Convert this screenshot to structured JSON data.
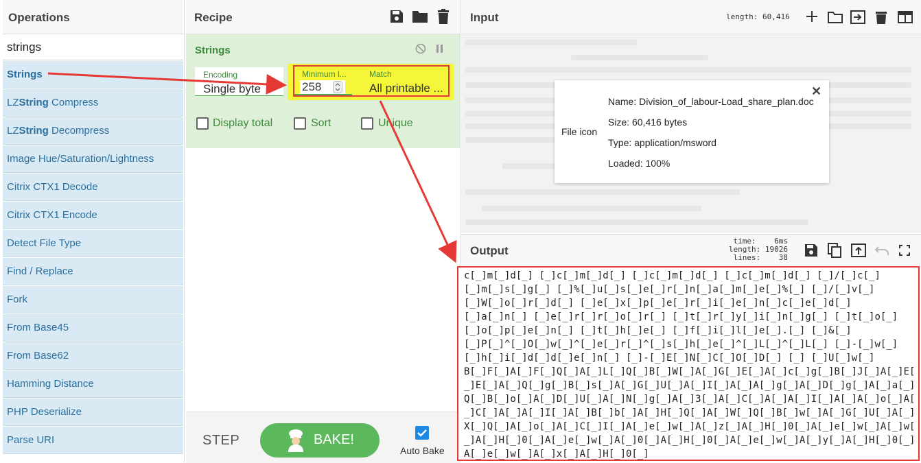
{
  "operations": {
    "title": "Operations",
    "search_value": "strings",
    "items": [
      {
        "pre": "",
        "bold": "Strings",
        "post": ""
      },
      {
        "pre": "LZ",
        "bold": "String",
        "post": " Compress"
      },
      {
        "pre": "LZ",
        "bold": "String",
        "post": " Decompress"
      },
      {
        "pre": "Image Hue/Saturation/Lightness",
        "bold": "",
        "post": ""
      },
      {
        "pre": "Citrix CTX1 Decode",
        "bold": "",
        "post": ""
      },
      {
        "pre": "Citrix CTX1 Encode",
        "bold": "",
        "post": ""
      },
      {
        "pre": "Detect File Type",
        "bold": "",
        "post": ""
      },
      {
        "pre": "Find / Replace",
        "bold": "",
        "post": ""
      },
      {
        "pre": "Fork",
        "bold": "",
        "post": ""
      },
      {
        "pre": "From Base45",
        "bold": "",
        "post": ""
      },
      {
        "pre": "From Base62",
        "bold": "",
        "post": ""
      },
      {
        "pre": "Hamming Distance",
        "bold": "",
        "post": ""
      },
      {
        "pre": "PHP Deserialize",
        "bold": "",
        "post": ""
      },
      {
        "pre": "Parse URI",
        "bold": "",
        "post": ""
      }
    ]
  },
  "recipe": {
    "title": "Recipe",
    "operation": {
      "name": "Strings",
      "encoding_label": "Encoding",
      "encoding_value": "Single byte",
      "min_length_label": "Minimum l...",
      "min_length_value": "258",
      "match_label": "Match",
      "match_value": "All printable ...",
      "display_total": "Display total",
      "sort": "Sort",
      "unique": "Unique"
    },
    "step_label": "STEP",
    "bake_label": "BAKE!",
    "auto_bake_label": "Auto Bake",
    "auto_bake_checked": true
  },
  "input": {
    "title": "Input",
    "length_text": "length: 60,416",
    "file": {
      "icon_label": "File icon",
      "name": "Name: Division_of_labour-Load_share_plan.doc",
      "size": "Size: 60,416 bytes",
      "type": "Type: application/msword",
      "loaded": "Loaded: 100%"
    }
  },
  "output": {
    "title": "Output",
    "time": "time:    6ms",
    "length": "length: 19026",
    "lines": "lines:    38",
    "text": "c[_]m[_]d[_] [_]c[_]m[_]d[_] [_]c[_]m[_]d[_] [_]c[_]m[_]d[_] [_]/[_]c[_]\n[_]m[_]s[_]g[_] [_]%[_]u[_]s[_]e[_]r[_]n[_]a[_]m[_]e[_]%[_] [_]/[_]v[_]\n[_]W[_]o[_]r[_]d[_] [_]e[_]x[_]p[_]e[_]r[_]i[_]e[_]n[_]c[_]e[_]d[_]\n[_]a[_]n[_] [_]e[_]r[_]r[_]o[_]r[_] [_]t[_]r[_]y[_]i[_]n[_]g[_] [_]t[_]o[_]\n[_]o[_]p[_]e[_]n[_] [_]t[_]h[_]e[_] [_]f[_]i[_]l[_]e[_].[_] [_]&[_]\n[_]P[_]^[_]O[_]w[_]^[_]e[_]r[_]^[_]s[_]h[_]e[_]^[_]L[_]^[_]L[_] [_]-[_]w[_]\n[_]h[_]i[_]d[_]d[_]e[_]n[_] [_]-[_]E[_]N[_]C[_]O[_]D[_] [_] [_]U[_]w[_]\nB[_]F[_]A[_]F[_]Q[_]A[_]L[_]Q[_]B[_]W[_]A[_]G[_]E[_]A[_]c[_]g[_]B[_]J[_]A[_]E[\n_]E[_]A[_]Q[_]g[_]B[_]s[_]A[_]G[_]U[_]A[_]I[_]A[_]A[_]g[_]A[_]D[_]g[_]A[_]a[_]\nQ[_]B[_]o[_]A[_]D[_]U[_]A[_]N[_]g[_]A[_]3[_]A[_]C[_]A[_]A[_]I[_]A[_]A[_]o[_]A[\n_]C[_]A[_]A[_]I[_]A[_]B[_]b[_]A[_]H[_]Q[_]A[_]W[_]Q[_]B[_]w[_]A[_]G[_]U[_]A[_]\nX[_]Q[_]A[_]o[_]A[_]C[_]I[_]A[_]e[_]w[_]A[_]z[_]A[_]H[_]0[_]A[_]e[_]w[_]A[_]w[\n_]A[_]H[_]0[_]A[_]e[_]w[_]A[_]0[_]A[_]H[_]0[_]A[_]e[_]w[_]A[_]y[_]A[_]H[_]0[_]\nA[_]e[_]w[_]A[_]x[_]A[_]H[_]0[_]"
  },
  "colors": {
    "op_bg": "#d9eaf4",
    "op_text": "#2a6f9e",
    "recipe_bg": "#dff0d8",
    "bake_green": "#5cb85c",
    "highlight_yellow": "#f5f53a",
    "annotation_red": "#e53935"
  }
}
